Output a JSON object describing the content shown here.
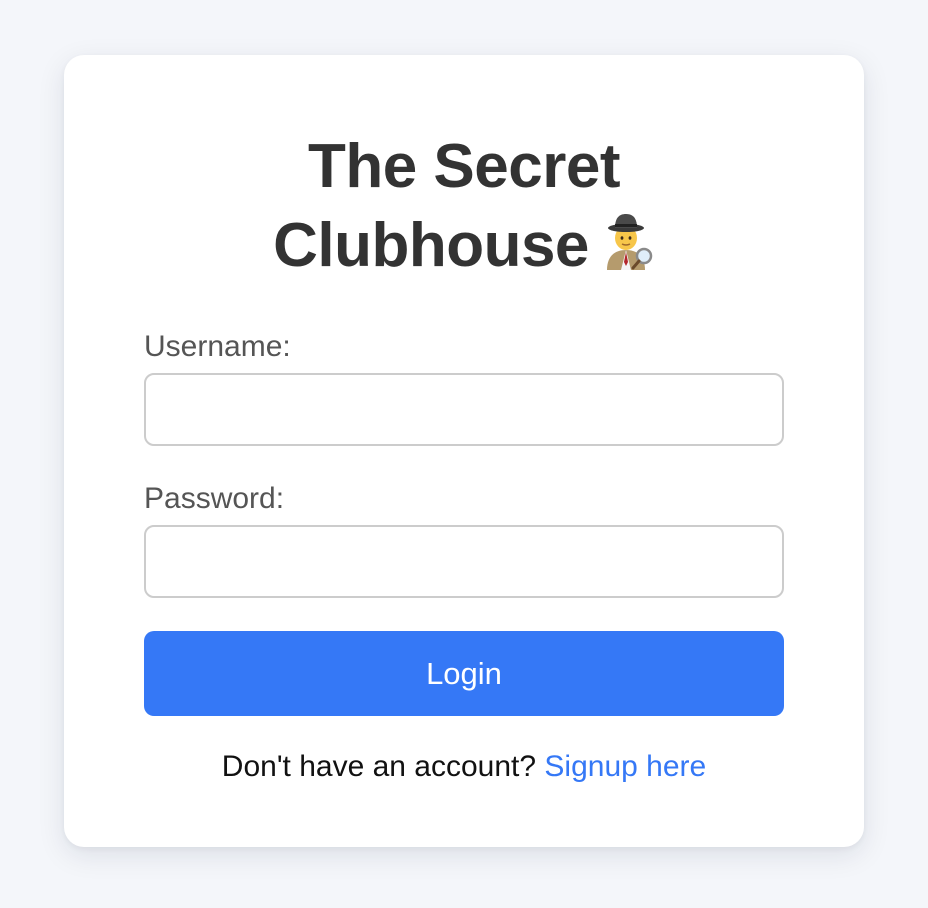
{
  "page": {
    "background_color": "#f4f6fa"
  },
  "login_card": {
    "title_line1": "The Secret",
    "title_line2": "Clubhouse",
    "title_icon": "detective-icon",
    "username_label": "Username:",
    "username_value": "",
    "password_label": "Password:",
    "password_value": "",
    "login_button_label": "Login",
    "signup_prompt": "Don't have an account?",
    "signup_link_label": "Signup here"
  },
  "colors": {
    "accent": "#3578f6",
    "title_text": "#333333",
    "label_text": "#555555",
    "input_border": "#cccccc",
    "card_background": "#ffffff"
  }
}
